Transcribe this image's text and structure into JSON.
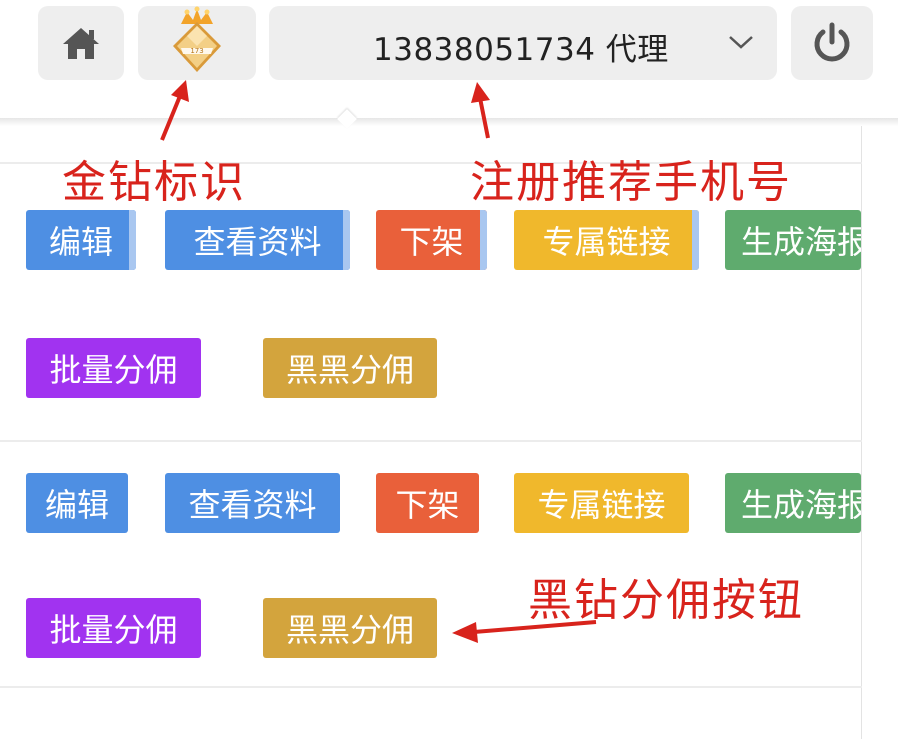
{
  "header": {
    "phone_selector": "13838051734 代理",
    "diamond_badge_text": "173",
    "icons": [
      "home-icon",
      "gold-diamond-icon",
      "chevron-down-icon",
      "power-icon"
    ]
  },
  "annotations": {
    "gold_diamond": "金钻标识",
    "phone": "注册推荐手机号",
    "black_button": "黑钻分佣按钮"
  },
  "rows": [
    {
      "buttons": [
        "编辑",
        "查看资料",
        "下架",
        "专属链接",
        "生成海报"
      ],
      "secondary": [
        "批量分佣",
        "黑黑分佣"
      ]
    },
    {
      "buttons": [
        "编辑",
        "查看资料",
        "下架",
        "专属链接",
        "生成海报"
      ],
      "secondary": [
        "批量分佣",
        "黑黑分佣"
      ]
    }
  ],
  "colors": {
    "blue": "#4e8fe3",
    "orange": "#e9603a",
    "yellow": "#f0b82c",
    "green": "#5fab6e",
    "purple": "#a133f0",
    "gold": "#d3a43d",
    "annotation_red": "#d8231c"
  }
}
